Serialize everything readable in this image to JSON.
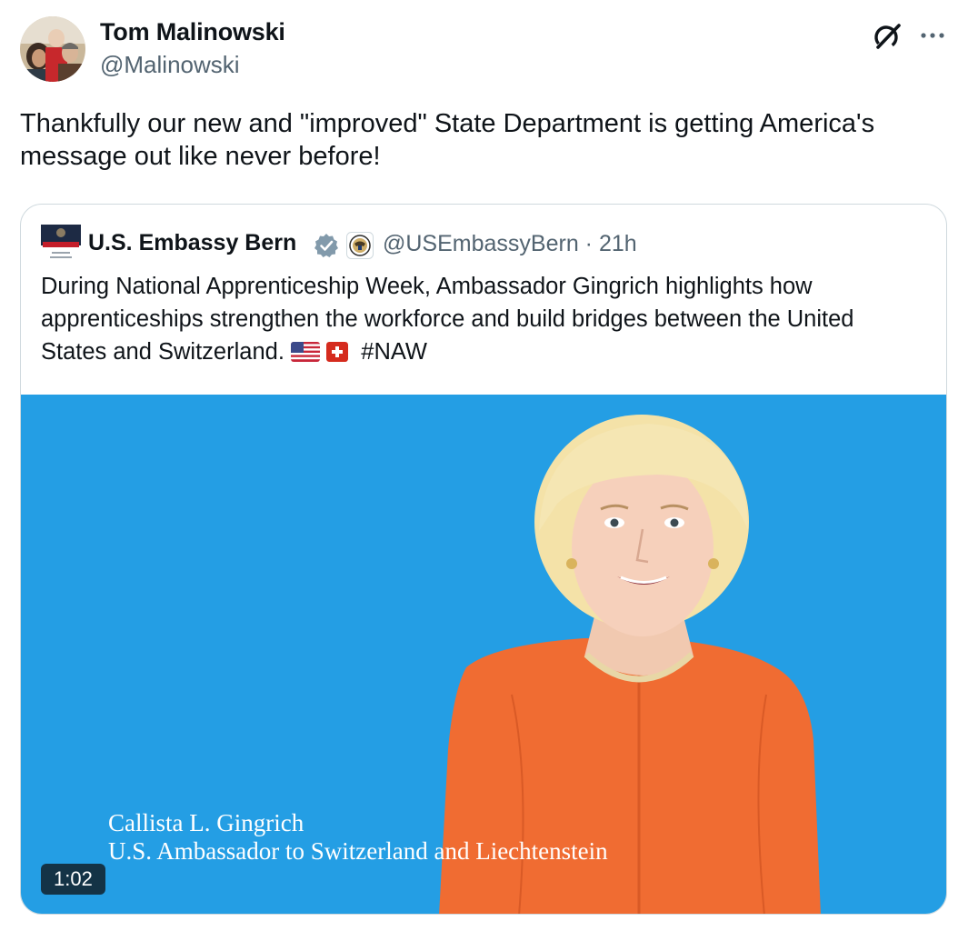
{
  "author": {
    "display_name": "Tom Malinowski",
    "handle": "@Malinowski",
    "avatar_icon": "profile-photo"
  },
  "tweet": {
    "text": "Thankfully our new and \"improved\" State Department is getting America's message out like never before!"
  },
  "header_actions": {
    "grok_icon": "grok-icon",
    "more_icon": "more-icon"
  },
  "quoted": {
    "display_name": "U.S. Embassy Bern",
    "handle_time": "@USEmbassyBern · 21h",
    "text_main": "During National Apprenticeship Week, Ambassador Gingrich highlights how apprenticeships strengthen the workforce and build bridges between the United States and Switzerland.",
    "hashtag": "#NAW",
    "verified_color": "#829aab",
    "video": {
      "caption_name": "Callista L. Gingrich",
      "caption_title": "U.S. Ambassador to Switzerland and Liechtenstein",
      "duration": "1:02",
      "background_color": "#249ee4"
    }
  },
  "colors": {
    "text_primary": "#0f1419",
    "text_secondary": "#536471",
    "border": "#cfd9de"
  }
}
